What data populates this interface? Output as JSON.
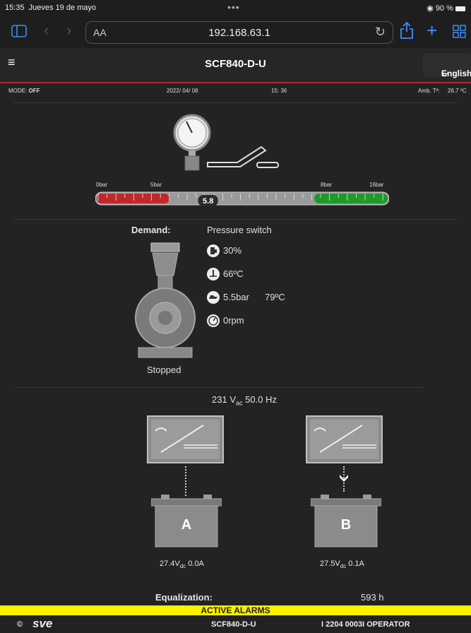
{
  "status_bar": {
    "time": "15:35",
    "date": "Jueves 19 de mayo",
    "battery": "90 %"
  },
  "browser": {
    "text_size_label": "AA",
    "url": "192.168.63.1"
  },
  "header": {
    "title": "SCF840-D-U",
    "language": "English"
  },
  "info": {
    "mode_label": "MODE:",
    "mode_value": "OFF",
    "date": "2022/ 04/ 08",
    "time": "15: 36",
    "amb_label": "Amb. Tª:",
    "amb_value": "26.7 ºC"
  },
  "gauge": {
    "labels": [
      "0bar",
      "5bar",
      "8bar",
      "16bar"
    ],
    "value": "5.8",
    "value_number": 5.8
  },
  "engine": {
    "demand_label": "Demand:",
    "demand_value": "Pressure switch",
    "fuel": "30%",
    "coolant_temp": "66ºC",
    "oil_pressure": "5.5bar",
    "oil_temp": "79ºC",
    "rpm": "0rpm",
    "state": "Stopped",
    "icons": [
      "fuel-icon",
      "coolant-icon",
      "oil-icon",
      "tachometer-icon"
    ]
  },
  "power": {
    "voltage": "231",
    "unit_main": "V",
    "unit_sub": "ac",
    "freq": "50.0 Hz"
  },
  "chargers": [
    {
      "battery_label": "A",
      "voltage": "27.4V",
      "unit_sub": "dc",
      "current": "0.0A"
    },
    {
      "battery_label": "B",
      "voltage": "27.5V",
      "unit_sub": "dc",
      "current": "0.1A"
    }
  ],
  "equalization": {
    "label": "Equalization:",
    "value": "593 h"
  },
  "alarms": {
    "label": "ACTIVE ALARMS"
  },
  "footer": {
    "copyright": "©",
    "brand": "sve",
    "model": "SCF840-D-U",
    "user": "I 2204 0003I OPERATOR"
  },
  "colors": {
    "accent_red": "#b12a2a",
    "ios_blue": "#3d8ef7",
    "alarm_yellow": "#ffef00",
    "gauge_red": "#c0282b",
    "gauge_green": "#1f9a2a"
  }
}
